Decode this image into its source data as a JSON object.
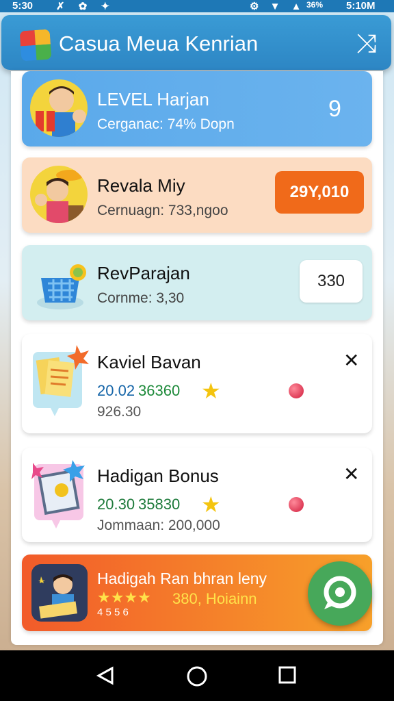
{
  "status": {
    "time_left": "5:30",
    "battery": "36%",
    "clock": "5:10M"
  },
  "header": {
    "title": "Casua Meua Kenrian"
  },
  "cards": [
    {
      "title": "LEVEL Harjan",
      "sub": "Cerganac: 74% Dopn"
    },
    {
      "title": "Revala Miy",
      "sub": "Cernuagn: 733,ngoo",
      "badge": "29Y,010"
    },
    {
      "title": "RevParajan",
      "sub": "Cornme: 3,30",
      "badge": "330"
    },
    {
      "title": "Kaviel Bavan",
      "value_a": "20.02",
      "value_b": "36360",
      "sub": "926.30"
    },
    {
      "title": "Hadigan Bonus",
      "value_a": "20.30",
      "value_b": "35830",
      "sub": "Jommaan: 200,000"
    },
    {
      "title": "Hadigah Ran bhran leny",
      "stars": "★★★★",
      "bonus": "380, Hoiainn",
      "small": "4 5 5 6"
    }
  ],
  "colors": {
    "header": "#2d86c4",
    "accent_orange": "#f06a1a",
    "fab": "#47a85a"
  }
}
